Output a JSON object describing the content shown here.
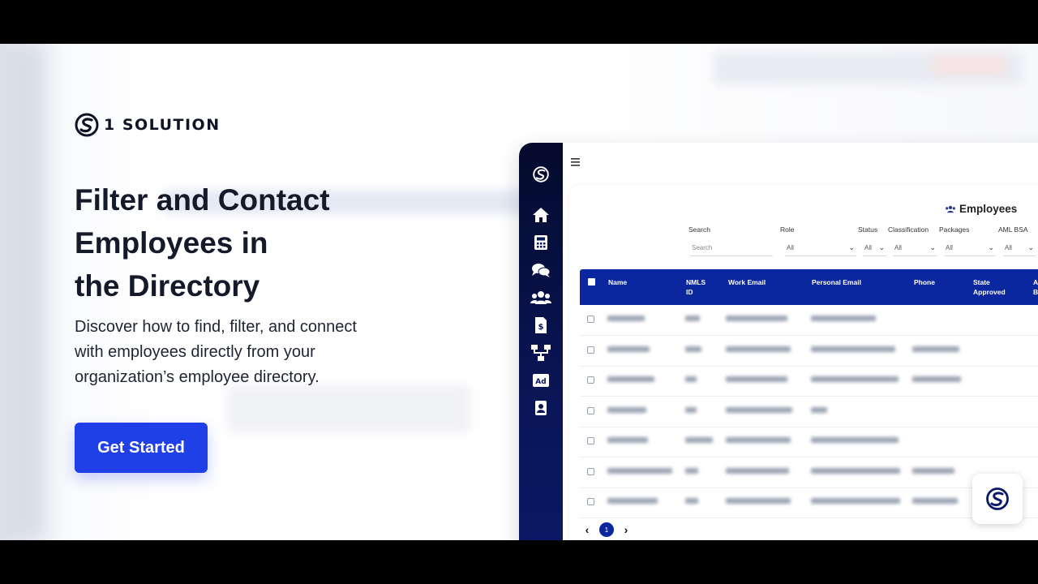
{
  "brand": {
    "name": "1 SOLUTION",
    "logo_icon": "s-swoosh-logo-icon"
  },
  "hero": {
    "title_line1": "Filter and Contact",
    "title_line2": "Employees in",
    "title_line3": "the Directory",
    "description_line1": "Discover how to find, filter, and connect",
    "description_line2": "with employees directly from your",
    "description_line3": "organization’s employee directory.",
    "cta_label": "Get Started"
  },
  "colors": {
    "cta": "#1e40e6",
    "sidebar": "#0a1556",
    "table_header": "#0b27a0",
    "text_dark": "#151a2a"
  },
  "app": {
    "menu_icon": "hamburger-icon",
    "sidebar_icons": [
      "logo-icon",
      "home-icon",
      "calculator-icon",
      "chat-icon",
      "users-icon",
      "invoice-icon",
      "org-chart-icon",
      "ad-icon",
      "contact-card-icon"
    ],
    "page_title": "Employees",
    "page_title_icon": "users-icon",
    "filters": {
      "search_label": "Search",
      "search_placeholder": "Search",
      "role_label": "Role",
      "role_value": "All",
      "status_label": "Status",
      "status_value": "All",
      "classification_label": "Classification",
      "classification_value": "All",
      "packages_label": "Packages",
      "packages_value": "All",
      "aml_label": "AML BSA",
      "aml_value": "All"
    },
    "table": {
      "columns": {
        "name": "Name",
        "nmls_line1": "NMLS",
        "nmls_line2": "ID",
        "work_email": "Work Email",
        "personal_email": "Personal Email",
        "phone": "Phone",
        "state_line1": "State",
        "state_line2": "Approved",
        "extra_line1": "A",
        "extra_line2": "B"
      },
      "row_count": 7
    },
    "pagination": {
      "current_page": "1",
      "prev_icon": "chevron-left-icon",
      "next_icon": "chevron-right-icon"
    }
  }
}
